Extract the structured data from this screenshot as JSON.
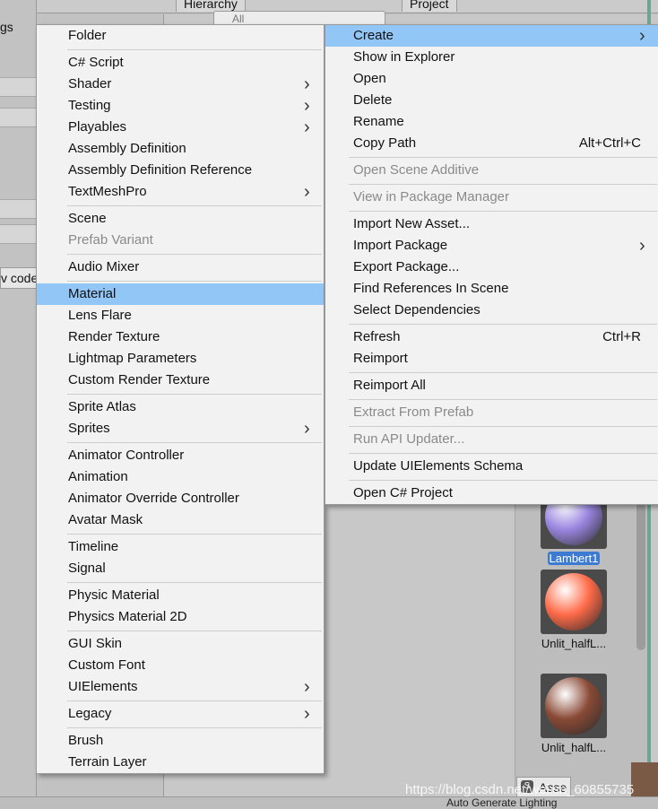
{
  "background": {
    "left_fragment_top": "gs",
    "left_code_box": "v code",
    "tabs": {
      "hierarchy": "Hierarchy",
      "project": "Project"
    },
    "hierarchy_search_placeholder": "All",
    "assets": [
      {
        "label": "Lambert1",
        "selected": true,
        "color": "#9a86e0"
      },
      {
        "label": "Unlit_halfL...",
        "selected": false,
        "color": "#ff6a48"
      },
      {
        "label": "Unlit_halfL...",
        "selected": false,
        "color": "#8a4a36"
      }
    ],
    "asset_chip": "Asse",
    "status_text": "Auto Generate Lighting",
    "watermark": "https://blog.csdn.net/weixin_60855735"
  },
  "left_menu": {
    "groups": [
      [
        {
          "label": "Folder"
        }
      ],
      [
        {
          "label": "C# Script"
        },
        {
          "label": "Shader",
          "submenu": true
        },
        {
          "label": "Testing",
          "submenu": true
        },
        {
          "label": "Playables",
          "submenu": true
        },
        {
          "label": "Assembly Definition"
        },
        {
          "label": "Assembly Definition Reference"
        },
        {
          "label": "TextMeshPro",
          "submenu": true
        }
      ],
      [
        {
          "label": "Scene"
        },
        {
          "label": "Prefab Variant",
          "disabled": true
        }
      ],
      [
        {
          "label": "Audio Mixer"
        }
      ],
      [
        {
          "label": "Material",
          "highlighted": true
        },
        {
          "label": "Lens Flare"
        },
        {
          "label": "Render Texture"
        },
        {
          "label": "Lightmap Parameters"
        },
        {
          "label": "Custom Render Texture"
        }
      ],
      [
        {
          "label": "Sprite Atlas"
        },
        {
          "label": "Sprites",
          "submenu": true
        }
      ],
      [
        {
          "label": "Animator Controller"
        },
        {
          "label": "Animation"
        },
        {
          "label": "Animator Override Controller"
        },
        {
          "label": "Avatar Mask"
        }
      ],
      [
        {
          "label": "Timeline"
        },
        {
          "label": "Signal"
        }
      ],
      [
        {
          "label": "Physic Material"
        },
        {
          "label": "Physics Material 2D"
        }
      ],
      [
        {
          "label": "GUI Skin"
        },
        {
          "label": "Custom Font"
        },
        {
          "label": "UIElements",
          "submenu": true
        }
      ],
      [
        {
          "label": "Legacy",
          "submenu": true
        }
      ],
      [
        {
          "label": "Brush"
        },
        {
          "label": "Terrain Layer"
        }
      ]
    ]
  },
  "right_menu": {
    "groups": [
      [
        {
          "label": "Create",
          "submenu": true,
          "highlighted": true
        },
        {
          "label": "Show in Explorer"
        },
        {
          "label": "Open"
        },
        {
          "label": "Delete"
        },
        {
          "label": "Rename"
        },
        {
          "label": "Copy Path",
          "shortcut": "Alt+Ctrl+C"
        }
      ],
      [
        {
          "label": "Open Scene Additive",
          "disabled": true
        }
      ],
      [
        {
          "label": "View in Package Manager",
          "disabled": true
        }
      ],
      [
        {
          "label": "Import New Asset..."
        },
        {
          "label": "Import Package",
          "submenu": true
        },
        {
          "label": "Export Package..."
        },
        {
          "label": "Find References In Scene"
        },
        {
          "label": "Select Dependencies"
        }
      ],
      [
        {
          "label": "Refresh",
          "shortcut": "Ctrl+R"
        },
        {
          "label": "Reimport"
        }
      ],
      [
        {
          "label": "Reimport All"
        }
      ],
      [
        {
          "label": "Extract From Prefab",
          "disabled": true
        }
      ],
      [
        {
          "label": "Run API Updater...",
          "disabled": true
        }
      ],
      [
        {
          "label": "Update UIElements Schema"
        }
      ],
      [
        {
          "label": "Open C# Project"
        }
      ]
    ]
  },
  "colors": {
    "highlight": "#92c6f6",
    "menu_bg": "#f2f2f2",
    "disabled_text": "#8a8a8a"
  }
}
